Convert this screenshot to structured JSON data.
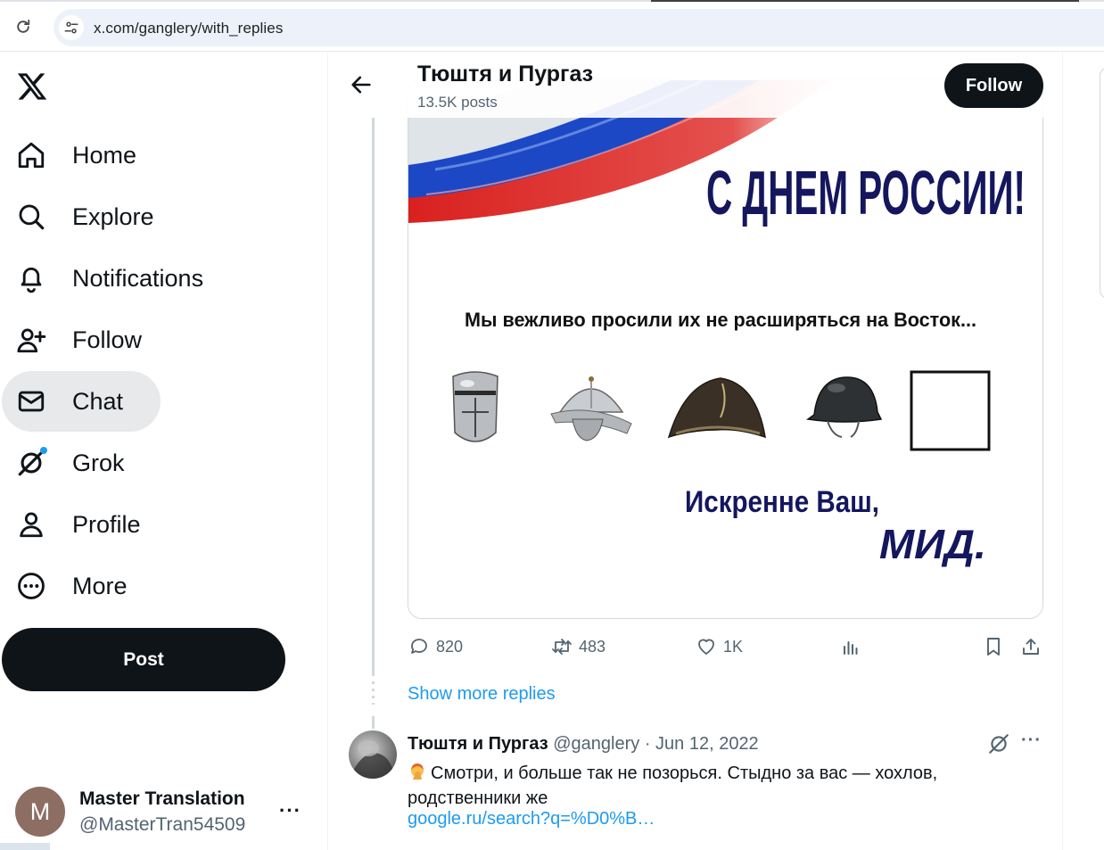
{
  "browser": {
    "url": "x.com/ganglery/with_replies"
  },
  "sidebar": {
    "items": [
      {
        "label": "Home",
        "icon": "home-icon"
      },
      {
        "label": "Explore",
        "icon": "search-icon"
      },
      {
        "label": "Notifications",
        "icon": "bell-icon"
      },
      {
        "label": "Follow",
        "icon": "person-plus-icon"
      },
      {
        "label": "Chat",
        "icon": "mail-icon",
        "active": true
      },
      {
        "label": "Grok",
        "icon": "grok-icon",
        "badge": true
      },
      {
        "label": "Profile",
        "icon": "person-icon"
      },
      {
        "label": "More",
        "icon": "more-circle-icon"
      }
    ],
    "post_label": "Post",
    "account": {
      "initial": "M",
      "name": "Master Translation",
      "handle": "@MasterTran54509",
      "more": "···",
      "avatar_color": "#8d6e63"
    }
  },
  "header": {
    "name": "Тюштя и Пургаз",
    "posts": "13.5K posts",
    "follow_label": "Follow"
  },
  "tweet": {
    "image": {
      "headline": "С ДНЕМ РОССИИ!",
      "line": "Мы вежливо просили их не расширяться на Восток...",
      "signoff": "Искренне Ваш,",
      "signature": "МИД.",
      "flag_colors": [
        "#ffffff",
        "#1c48c6",
        "#d9211f"
      ],
      "text_color": "#14175e"
    },
    "stats": {
      "replies": "820",
      "reposts": "483",
      "likes": "1K"
    }
  },
  "show_more": "Show more replies",
  "reply": {
    "name": "Тюштя и Пургаз",
    "meta": "@ganglery · Jun 12, 2022",
    "text": "Смотри, и больше так не позорься. Стыдно за вас — хохлов, родственники же",
    "link": "google.ru/search?q=%D0%B…",
    "more": "···"
  },
  "colors": {
    "accent": "#1d9bf0",
    "text": "#0f1419",
    "muted": "#536471",
    "border": "#cfd9de"
  }
}
